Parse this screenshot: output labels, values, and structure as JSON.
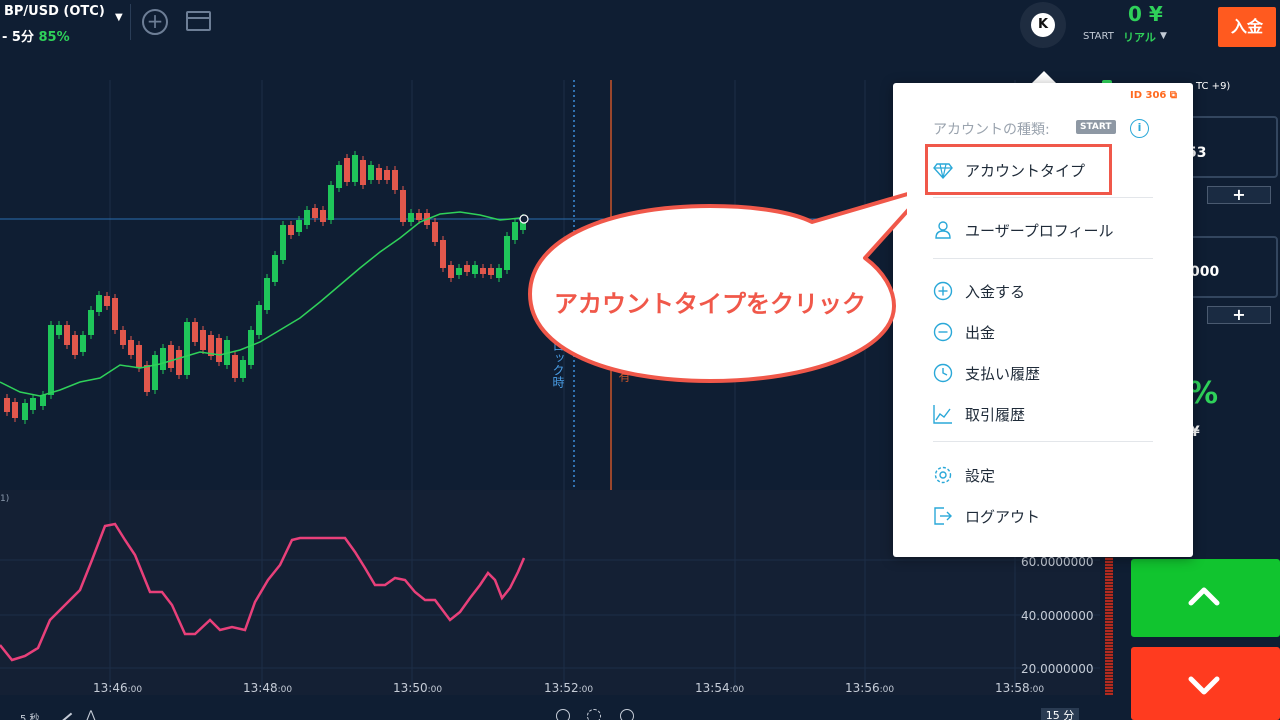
{
  "header": {
    "asset_name": "BP/USD (OTC)",
    "asset_sub": "- 5分",
    "payout": "85%",
    "balance": "0 ¥",
    "account_label": "START",
    "account_type": "リアル",
    "deposit_label": "入金",
    "avatar_letter": "K"
  },
  "chart": {
    "lock_label": "ロック時",
    "expiry_label": "有",
    "oscillator_label": "1)",
    "y_ticks": [
      "60.0000000",
      "40.0000000",
      "20.0000000"
    ],
    "x_ticks": [
      {
        "time": "13:46",
        "sec": ":00"
      },
      {
        "time": "13:48",
        "sec": ":00"
      },
      {
        "time": "13:50",
        "sec": ":00"
      },
      {
        "time": "13:52",
        "sec": ":00"
      },
      {
        "time": "13:54",
        "sec": ":00"
      },
      {
        "time": "13:56",
        "sec": ":00"
      },
      {
        "time": "13:58",
        "sec": ":00"
      }
    ],
    "interval_seconds": "5 秒",
    "interval_button": "15 分"
  },
  "right_panel": {
    "timezone": "TC +9)",
    "field1_value": "53",
    "field2_value": "000",
    "plus": "+",
    "payout_pct": "%",
    "profit": "¥"
  },
  "menu": {
    "account_id": "ID 306",
    "account_kind_label": "アカウントの種類:",
    "account_kind_badge": "START",
    "items": [
      {
        "label": "アカウントタイプ",
        "icon": "diamond-icon"
      },
      {
        "label": "ユーザープロフィール",
        "icon": "user-icon"
      },
      {
        "label": "入金する",
        "icon": "plus-circle-icon"
      },
      {
        "label": "出金",
        "icon": "minus-circle-icon"
      },
      {
        "label": "支払い履歴",
        "icon": "clock-icon"
      },
      {
        "label": "取引履歴",
        "icon": "chart-line-icon"
      },
      {
        "label": "設定",
        "icon": "gear-icon"
      },
      {
        "label": "ログアウト",
        "icon": "logout-icon"
      }
    ]
  },
  "annotation": {
    "bubble_text": "アカウントタイプをクリック"
  },
  "colors": {
    "background": "#0f1e33",
    "up_candle": "#1fc65a",
    "down_candle": "#e2574c",
    "accent": "#2fd15a",
    "deposit": "#ff5a1f",
    "annotation": "#f0584a"
  }
}
